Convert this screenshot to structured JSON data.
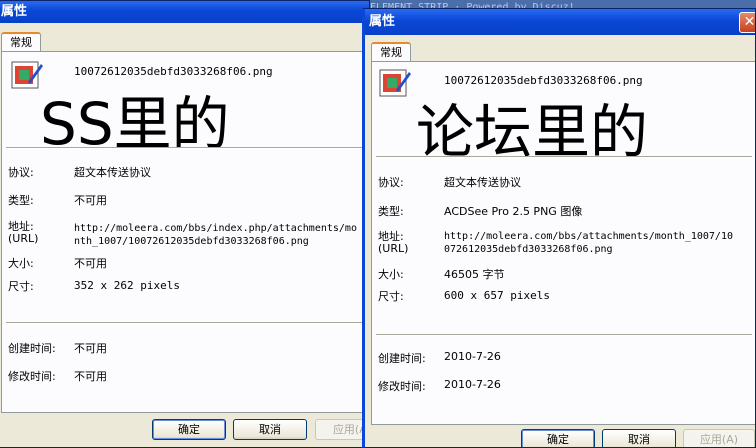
{
  "left": {
    "title": "属性",
    "tab": "常规",
    "filename": "10072612035debfd3033268f06.png",
    "big_text": "SS里的",
    "rows": {
      "protocol_label": "协议:",
      "protocol_value": "超文本传送协议",
      "type_label": "类型:",
      "type_value": "不可用",
      "address_label": "地址:",
      "address_sub": "(URL)",
      "address_value": "http://moleera.com/bbs/index.php/attachments/month_1007/10072612035debfd3033268f06.png",
      "size_label": "大小:",
      "size_value": "不可用",
      "dims_label": "尺寸:",
      "dims_value": "352  x  262  pixels",
      "created_label": "创建时间:",
      "created_value": "不可用",
      "modified_label": "修改时间:",
      "modified_value": "不可用"
    },
    "buttons": {
      "ok": "确定",
      "cancel": "取消",
      "apply": "应用(A)"
    }
  },
  "right": {
    "title": "属性",
    "close": "✕",
    "tab": "常规",
    "filename": "10072612035debfd3033268f06.png",
    "big_text": "论坛里的",
    "rows": {
      "protocol_label": "协议:",
      "protocol_value": "超文本传送协议",
      "type_label": "类型:",
      "type_value": "ACDSee Pro 2.5 PNG 图像",
      "address_label": "地址:",
      "address_sub": "(URL)",
      "address_value": "http://moleera.com/bbs/attachments/month_1007/10072612035debfd3033268f06.png",
      "size_label": "大小:",
      "size_value": "46505 字节",
      "dims_label": "尺寸:",
      "dims_value": "600  x  657  pixels",
      "created_label": "创建时间:",
      "created_value": "2010-7-26",
      "modified_label": "修改时间:",
      "modified_value": "2010-7-26"
    },
    "buttons": {
      "ok": "确定",
      "cancel": "取消",
      "apply": "应用(A)"
    }
  },
  "background_text": "ELEMENT STRIP · Powered by Discuz!"
}
